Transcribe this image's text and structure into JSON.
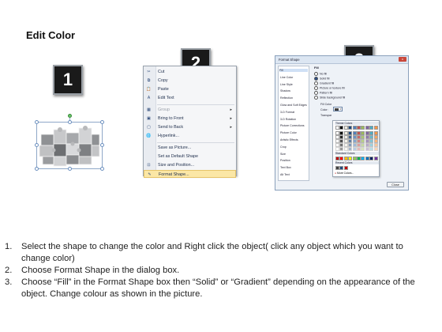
{
  "slide": {
    "title": "Edit Color",
    "badges": [
      "1",
      "2",
      "3"
    ]
  },
  "context_menu": {
    "items": [
      {
        "label": "Cut",
        "icon": "scissors-icon",
        "glyph": "✂",
        "submenu": false,
        "disabled": false,
        "highlighted": false
      },
      {
        "label": "Copy",
        "icon": "copy-icon",
        "glyph": "⧉",
        "submenu": false,
        "disabled": false,
        "highlighted": false
      },
      {
        "label": "Paste",
        "icon": "paste-icon",
        "glyph": "📋",
        "submenu": false,
        "disabled": false,
        "highlighted": false
      },
      {
        "label": "Edit Text",
        "icon": "edit-text-icon",
        "glyph": "A",
        "submenu": false,
        "disabled": false,
        "highlighted": false
      },
      {
        "label": "Group",
        "icon": "group-icon",
        "glyph": "▦",
        "submenu": true,
        "disabled": true,
        "highlighted": false
      },
      {
        "label": "Bring to Front",
        "icon": "bring-front-icon",
        "glyph": "▣",
        "submenu": true,
        "disabled": false,
        "highlighted": false
      },
      {
        "label": "Send to Back",
        "icon": "send-back-icon",
        "glyph": "▢",
        "submenu": true,
        "disabled": false,
        "highlighted": false
      },
      {
        "label": "Hyperlink...",
        "icon": "hyperlink-icon",
        "glyph": "🌐",
        "submenu": false,
        "disabled": false,
        "highlighted": false
      },
      {
        "label": "Save as Picture...",
        "icon": "",
        "glyph": "",
        "submenu": false,
        "disabled": false,
        "highlighted": false
      },
      {
        "label": "Set as Default Shape",
        "icon": "",
        "glyph": "",
        "submenu": false,
        "disabled": false,
        "highlighted": false
      },
      {
        "label": "Size and Position...",
        "icon": "size-position-icon",
        "glyph": "⊡",
        "submenu": false,
        "disabled": false,
        "highlighted": false
      },
      {
        "label": "Format Shape...",
        "icon": "format-shape-icon",
        "glyph": "✎",
        "submenu": false,
        "disabled": false,
        "highlighted": true
      }
    ]
  },
  "format_dialog": {
    "title": "Format Shape",
    "close_glyph": "x",
    "nav": [
      "Fill",
      "Line Color",
      "Line Style",
      "Shadow",
      "Reflection",
      "Glow and Soft Edges",
      "3-D Format",
      "3-D Rotation",
      "Picture Corrections",
      "Picture Color",
      "Artistic Effects",
      "Crop",
      "Size",
      "Position",
      "Text Box",
      "Alt Text"
    ],
    "section_title": "Fill",
    "fill_options": [
      {
        "label": "No fill",
        "selected": false
      },
      {
        "label": "Solid fill",
        "selected": true
      },
      {
        "label": "Gradient fill",
        "selected": false
      },
      {
        "label": "Picture or texture fill",
        "selected": false
      },
      {
        "label": "Pattern fill",
        "selected": false
      },
      {
        "label": "Slide background fill",
        "selected": false
      }
    ],
    "fill_color_label": "Fill Color",
    "color_label": "Color:",
    "transparency_label": "Transpar",
    "theme_colors_label": "Theme Colors",
    "standard_colors_label": "Standard Colors",
    "recent_colors_label": "Recent Colors",
    "more_colors_label": "More Colors...",
    "close_label": "Close",
    "theme_colors": [
      "#ffffff",
      "#000000",
      "#eeece1",
      "#1f497d",
      "#4f81bd",
      "#c0504d",
      "#9bbb59",
      "#8064a2",
      "#4bacc6",
      "#f79646"
    ],
    "standard_colors": [
      "#c00000",
      "#ff0000",
      "#ffc000",
      "#ffff00",
      "#92d050",
      "#00b050",
      "#00b0f0",
      "#0070c0",
      "#002060",
      "#7030a0"
    ],
    "recent_colors": [
      "#404040",
      "#1f497d",
      "#c00000"
    ]
  },
  "instructions": [
    {
      "num": "1.",
      "text": "Select the shape to change the color and Right click the object( click any object which you want to change color)"
    },
    {
      "num": "2.",
      "text": "Choose Format Shape in the dialog box."
    },
    {
      "num": "3.",
      "text": "Choose “Fill” in the Format Shape box then “Solid” or “Gradient” depending on the appearance of the object. Change colour as shown in the picture."
    }
  ],
  "colors": {
    "badge_bg": "#1a1a1a",
    "menu_highlight": "#fbe7a6",
    "puzzle_light": "#c9cacc",
    "puzzle_dark": "#6d6f72"
  }
}
